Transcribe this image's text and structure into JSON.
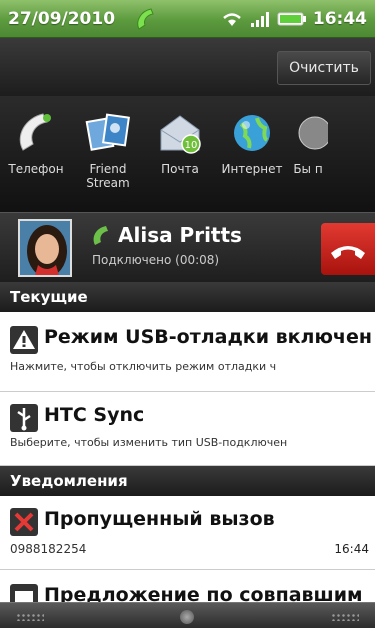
{
  "statusbar": {
    "date": "27/09/2010",
    "time": "16:44"
  },
  "toolbar": {
    "clear_label": "Очистить"
  },
  "quick_launch": [
    {
      "label": "Телефон",
      "icon": "phone-icon"
    },
    {
      "label": "Friend Stream",
      "icon": "friend-stream-icon"
    },
    {
      "label": "Почта",
      "icon": "mail-icon",
      "badge": "10"
    },
    {
      "label": "Интернет",
      "icon": "globe-icon"
    },
    {
      "label": "Бы п",
      "icon": "app-icon"
    }
  ],
  "call": {
    "name": "Alisa Pritts",
    "status": "Подключено (00:08)"
  },
  "sections": {
    "current": "Текущие",
    "notifications": "Уведомления"
  },
  "items": {
    "usb": {
      "title": "Режим USB-отладки включен",
      "subtitle": "Нажмите, чтобы отключить режим отладки ч"
    },
    "htc": {
      "title": "HTC Sync",
      "subtitle": "Выберите, чтобы изменить тип USB-подключен"
    },
    "missed": {
      "title": "Пропущенный вызов",
      "subtitle": "0988182254",
      "time": "16:44"
    },
    "offer": {
      "title": "Предложение по совпавшим"
    }
  },
  "colors": {
    "statusbar": "#5c9a3e",
    "hangup": "#d22a22",
    "call_green": "#6cc04a"
  }
}
